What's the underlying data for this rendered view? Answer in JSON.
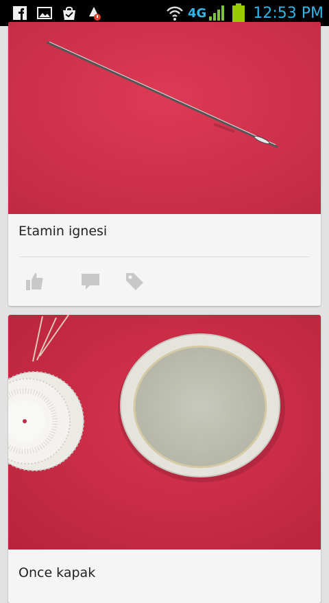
{
  "status_bar": {
    "network_label": "4G",
    "time": "12:53 PM",
    "icons": [
      "facebook-icon",
      "gallery-icon",
      "shopping-bag-icon",
      "app-update-icon",
      "wifi-icon",
      "signal-icon",
      "battery-icon"
    ],
    "accent_color": "#33b5e5"
  },
  "feed": {
    "cards": [
      {
        "title": "Etamin ignesi",
        "image": "needle-photo",
        "actions": [
          "like-icon",
          "comment-icon",
          "tag-icon"
        ]
      },
      {
        "title": "Once kapak",
        "image": "lid-photo"
      }
    ]
  },
  "colors": {
    "background": "#e2e2e2",
    "card": "#f5f5f5",
    "photo_red": "#d0314b",
    "icon_gray": "#c8c8c8"
  }
}
